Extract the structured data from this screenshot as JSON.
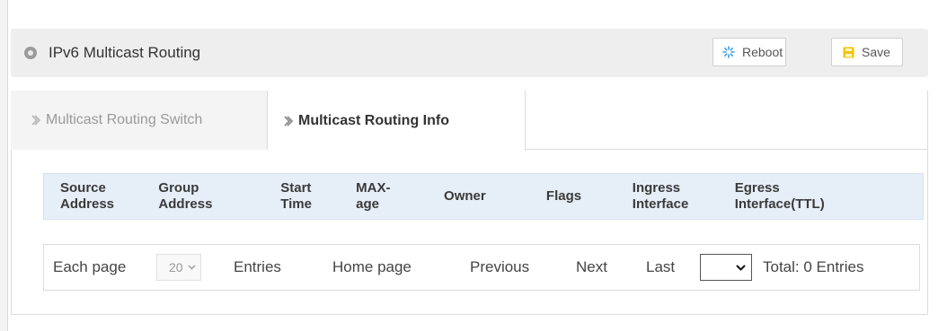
{
  "header": {
    "title": "IPv6 Multicast Routing",
    "reboot_label": "Reboot",
    "save_label": "Save"
  },
  "tabs": [
    {
      "label": "Multicast Routing Switch",
      "active": false
    },
    {
      "label": "Multicast Routing Info",
      "active": true
    }
  ],
  "table": {
    "columns": [
      [
        "Source",
        "Address"
      ],
      [
        "Group",
        "Address"
      ],
      [
        "Start",
        "Time"
      ],
      [
        "MAX-",
        "age"
      ],
      [
        "Owner",
        ""
      ],
      [
        "Flags",
        ""
      ],
      [
        "Ingress",
        "Interface"
      ],
      [
        "Egress",
        "Interface(TTL)"
      ]
    ],
    "rows": []
  },
  "pager": {
    "each_page": "Each page",
    "page_size": "20",
    "entries": "Entries",
    "home": "Home page",
    "previous": "Previous",
    "next": "Next",
    "last": "Last",
    "page_value": "",
    "total": "Total: 0 Entries"
  },
  "colors": {
    "table_header_bg": "#e6eff8",
    "save_icon": "#f5c400",
    "reboot_icon": "#3b9de0"
  }
}
